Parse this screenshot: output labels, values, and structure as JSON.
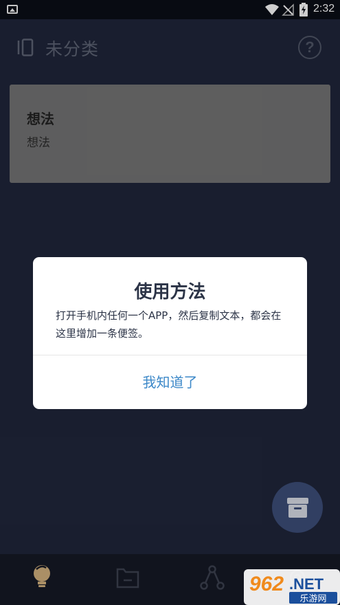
{
  "status_bar": {
    "time": "2:32",
    "icons": [
      "gallery-icon",
      "wifi-icon",
      "no-signal-icon",
      "battery-charging-icon"
    ]
  },
  "app_bar": {
    "title": "未分类",
    "left_icon": "sidebar-icon",
    "right_icon": "help-icon",
    "help_glyph": "?"
  },
  "notes": [
    {
      "title": "想法",
      "body": "想法"
    }
  ],
  "dialog": {
    "title": "使用方法",
    "message": "打开手机内任何一个APP，然后复制文本，都会在这里增加一条便签。",
    "confirm_label": "我知道了"
  },
  "fab": {
    "icon": "archive-icon"
  },
  "bottom_nav": {
    "items": [
      {
        "icon": "lightbulb-icon",
        "active": true
      },
      {
        "icon": "folder-icon",
        "active": false
      },
      {
        "icon": "share-icon",
        "active": false
      },
      {
        "icon": "settings-icon",
        "active": false
      }
    ]
  },
  "watermark": {
    "number": "962",
    "domain": ".NET",
    "tagline": "乐游网"
  },
  "colors": {
    "background": "#1e2438",
    "dialog_accent": "#3c88c8",
    "card": "#6e6e6f",
    "fab": "#3a4a74",
    "nav_active": "#c8a878"
  }
}
